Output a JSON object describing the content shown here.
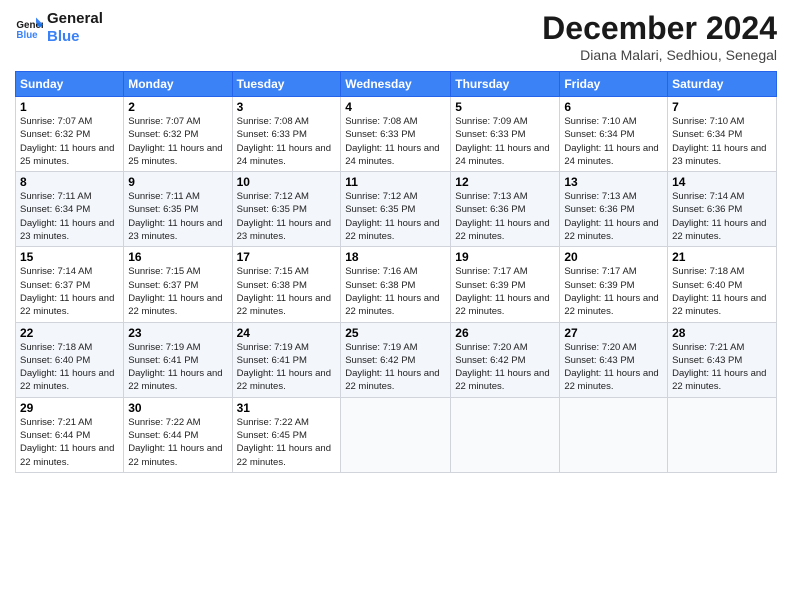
{
  "logo": {
    "line1": "General",
    "line2": "Blue"
  },
  "title": "December 2024",
  "location": "Diana Malari, Sedhiou, Senegal",
  "headers": [
    "Sunday",
    "Monday",
    "Tuesday",
    "Wednesday",
    "Thursday",
    "Friday",
    "Saturday"
  ],
  "weeks": [
    [
      {
        "day": "1",
        "sunrise": "7:07 AM",
        "sunset": "6:32 PM",
        "daylight": "11 hours and 25 minutes."
      },
      {
        "day": "2",
        "sunrise": "7:07 AM",
        "sunset": "6:32 PM",
        "daylight": "11 hours and 25 minutes."
      },
      {
        "day": "3",
        "sunrise": "7:08 AM",
        "sunset": "6:33 PM",
        "daylight": "11 hours and 24 minutes."
      },
      {
        "day": "4",
        "sunrise": "7:08 AM",
        "sunset": "6:33 PM",
        "daylight": "11 hours and 24 minutes."
      },
      {
        "day": "5",
        "sunrise": "7:09 AM",
        "sunset": "6:33 PM",
        "daylight": "11 hours and 24 minutes."
      },
      {
        "day": "6",
        "sunrise": "7:10 AM",
        "sunset": "6:34 PM",
        "daylight": "11 hours and 24 minutes."
      },
      {
        "day": "7",
        "sunrise": "7:10 AM",
        "sunset": "6:34 PM",
        "daylight": "11 hours and 23 minutes."
      }
    ],
    [
      {
        "day": "8",
        "sunrise": "7:11 AM",
        "sunset": "6:34 PM",
        "daylight": "11 hours and 23 minutes."
      },
      {
        "day": "9",
        "sunrise": "7:11 AM",
        "sunset": "6:35 PM",
        "daylight": "11 hours and 23 minutes."
      },
      {
        "day": "10",
        "sunrise": "7:12 AM",
        "sunset": "6:35 PM",
        "daylight": "11 hours and 23 minutes."
      },
      {
        "day": "11",
        "sunrise": "7:12 AM",
        "sunset": "6:35 PM",
        "daylight": "11 hours and 22 minutes."
      },
      {
        "day": "12",
        "sunrise": "7:13 AM",
        "sunset": "6:36 PM",
        "daylight": "11 hours and 22 minutes."
      },
      {
        "day": "13",
        "sunrise": "7:13 AM",
        "sunset": "6:36 PM",
        "daylight": "11 hours and 22 minutes."
      },
      {
        "day": "14",
        "sunrise": "7:14 AM",
        "sunset": "6:36 PM",
        "daylight": "11 hours and 22 minutes."
      }
    ],
    [
      {
        "day": "15",
        "sunrise": "7:14 AM",
        "sunset": "6:37 PM",
        "daylight": "11 hours and 22 minutes."
      },
      {
        "day": "16",
        "sunrise": "7:15 AM",
        "sunset": "6:37 PM",
        "daylight": "11 hours and 22 minutes."
      },
      {
        "day": "17",
        "sunrise": "7:15 AM",
        "sunset": "6:38 PM",
        "daylight": "11 hours and 22 minutes."
      },
      {
        "day": "18",
        "sunrise": "7:16 AM",
        "sunset": "6:38 PM",
        "daylight": "11 hours and 22 minutes."
      },
      {
        "day": "19",
        "sunrise": "7:17 AM",
        "sunset": "6:39 PM",
        "daylight": "11 hours and 22 minutes."
      },
      {
        "day": "20",
        "sunrise": "7:17 AM",
        "sunset": "6:39 PM",
        "daylight": "11 hours and 22 minutes."
      },
      {
        "day": "21",
        "sunrise": "7:18 AM",
        "sunset": "6:40 PM",
        "daylight": "11 hours and 22 minutes."
      }
    ],
    [
      {
        "day": "22",
        "sunrise": "7:18 AM",
        "sunset": "6:40 PM",
        "daylight": "11 hours and 22 minutes."
      },
      {
        "day": "23",
        "sunrise": "7:19 AM",
        "sunset": "6:41 PM",
        "daylight": "11 hours and 22 minutes."
      },
      {
        "day": "24",
        "sunrise": "7:19 AM",
        "sunset": "6:41 PM",
        "daylight": "11 hours and 22 minutes."
      },
      {
        "day": "25",
        "sunrise": "7:19 AM",
        "sunset": "6:42 PM",
        "daylight": "11 hours and 22 minutes."
      },
      {
        "day": "26",
        "sunrise": "7:20 AM",
        "sunset": "6:42 PM",
        "daylight": "11 hours and 22 minutes."
      },
      {
        "day": "27",
        "sunrise": "7:20 AM",
        "sunset": "6:43 PM",
        "daylight": "11 hours and 22 minutes."
      },
      {
        "day": "28",
        "sunrise": "7:21 AM",
        "sunset": "6:43 PM",
        "daylight": "11 hours and 22 minutes."
      }
    ],
    [
      {
        "day": "29",
        "sunrise": "7:21 AM",
        "sunset": "6:44 PM",
        "daylight": "11 hours and 22 minutes."
      },
      {
        "day": "30",
        "sunrise": "7:22 AM",
        "sunset": "6:44 PM",
        "daylight": "11 hours and 22 minutes."
      },
      {
        "day": "31",
        "sunrise": "7:22 AM",
        "sunset": "6:45 PM",
        "daylight": "11 hours and 22 minutes."
      },
      null,
      null,
      null,
      null
    ]
  ]
}
